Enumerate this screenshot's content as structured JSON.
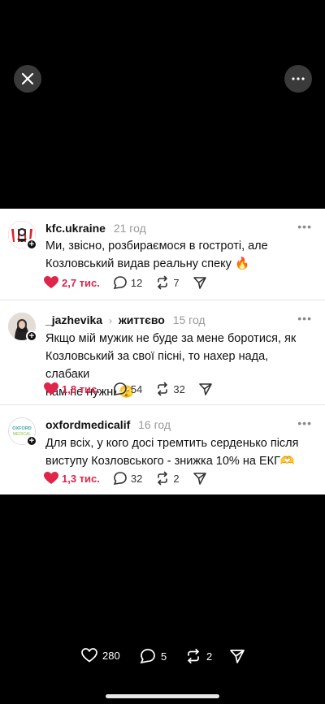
{
  "viewer": {
    "close_icon": "close-icon",
    "more_icon": "more-horizontal-icon"
  },
  "posts": [
    {
      "username": "kfc.ukraine",
      "time": "21 год",
      "text_lines": [
        "Ми, звісно, розбираємося в гостроті, але",
        "Козловський видав реальну спеку 🔥"
      ],
      "likes": "2,7 тис.",
      "replies": "12",
      "reposts": "7",
      "avatar_text": "KFC"
    },
    {
      "username": "_jazhevika",
      "topic": "життєво",
      "time": "15 год",
      "text_lines": [
        "Якщо мій мужик не буде за мене боротися, як",
        "Козловський за свої пісні, то нахер нада, слабаки",
        "нам не нужні 🫣"
      ],
      "likes": "1,8 тис.",
      "replies": "54",
      "reposts": "32"
    },
    {
      "username": "oxfordmedicalif",
      "time": "16 год",
      "text_lines": [
        "Для всіх, у кого досі тремтить серденько після",
        "виступу Козловського - знижка 10% на ЕКГ🫶"
      ],
      "likes": "1,3 тис.",
      "replies": "32",
      "reposts": "2",
      "avatar_text": "OXFORD MEDICAL"
    }
  ],
  "bottom": {
    "likes": "280",
    "comments": "5",
    "reposts": "2"
  },
  "colors": {
    "like_red": "#e0244a",
    "kfc_red": "#d9252c"
  }
}
